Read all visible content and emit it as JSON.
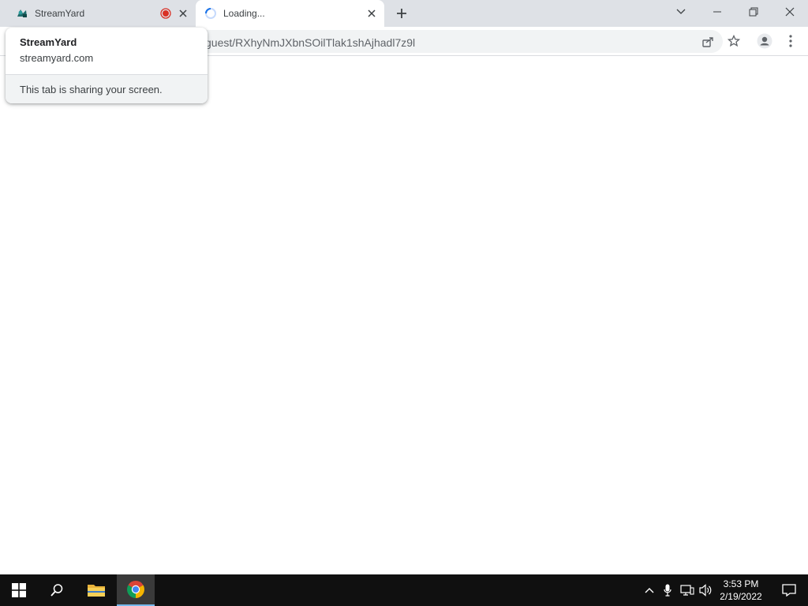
{
  "tabs": [
    {
      "title": "StreamYard",
      "icon": "streamyard-favicon-icon",
      "recording": true,
      "active": false
    },
    {
      "title": "Loading...",
      "icon": "loading-spinner-icon",
      "active": true
    }
  ],
  "toolbar": {
    "url": "guest/RXhyNmJXbnSOilTlak1shAjhadl7z9l"
  },
  "popup": {
    "title": "StreamYard",
    "domain": "streamyard.com",
    "message": "This tab is sharing your screen."
  },
  "taskbar": {
    "time": "3:53 PM",
    "date": "2/19/2022"
  },
  "colors": {
    "recording": "#d93025",
    "chrome_red": "#db4437",
    "chrome_green": "#0f9d58",
    "chrome_yellow": "#f4b400",
    "chrome_blue": "#4285f4"
  }
}
